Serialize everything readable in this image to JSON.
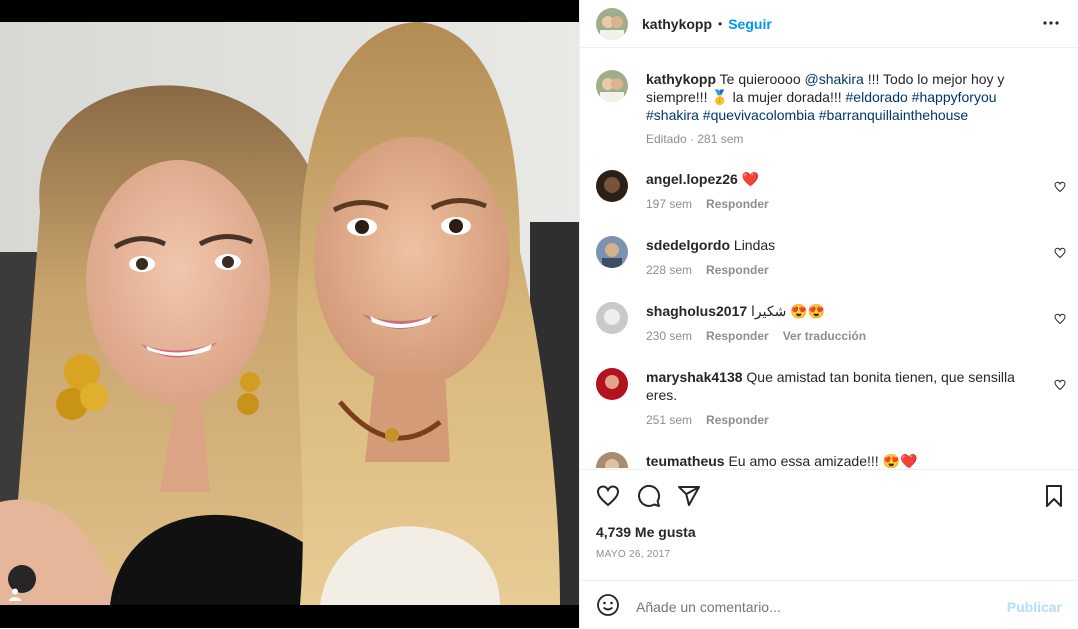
{
  "post": {
    "username": "kathykopp",
    "follow_label": "Seguir",
    "caption": {
      "username": "kathykopp",
      "text_1": "Te quieroooo",
      "mention": "@shakira",
      "text_2": "!!! Todo lo mejor hoy y siempre!!! 🥇 la mujer dorada!!!",
      "hashtags": "#eldorado #happyforyou #shakira #quevivacolombia #barranquillainthehouse",
      "meta": "Editado · 281 sem"
    }
  },
  "comments": [
    {
      "username": "angel.lopez26",
      "text": "❤️",
      "time": "197 sem",
      "reply": "Responder",
      "translate": ""
    },
    {
      "username": "sdedelgordo",
      "text": "Lindas",
      "time": "228 sem",
      "reply": "Responder",
      "translate": ""
    },
    {
      "username": "shagholus2017",
      "text": "شكيرا 😍😍",
      "time": "230 sem",
      "reply": "Responder",
      "translate": "Ver traducción"
    },
    {
      "username": "maryshak4138",
      "text": "Que amistad tan bonita tienen, que sensilla eres.",
      "time": "251 sem",
      "reply": "Responder",
      "translate": ""
    },
    {
      "username": "teumatheus",
      "text": "Eu amo essa amizade!!! 😍❤️",
      "time": "",
      "reply": "",
      "translate": ""
    }
  ],
  "likes": "4,739 Me gusta",
  "date": "MAYO 26, 2017",
  "add_comment": {
    "placeholder": "Añade un comentario...",
    "publish_label": "Publicar"
  },
  "icons": [
    "like-icon",
    "comment-icon",
    "share-icon",
    "save-icon",
    "emoji-icon",
    "more-icon",
    "user-tag-icon",
    "heart-small-icon"
  ],
  "colors": {
    "link": "#00376b",
    "follow": "#0095f6",
    "publish_disabled": "#b2dffc",
    "muted": "#8e8e8e"
  }
}
